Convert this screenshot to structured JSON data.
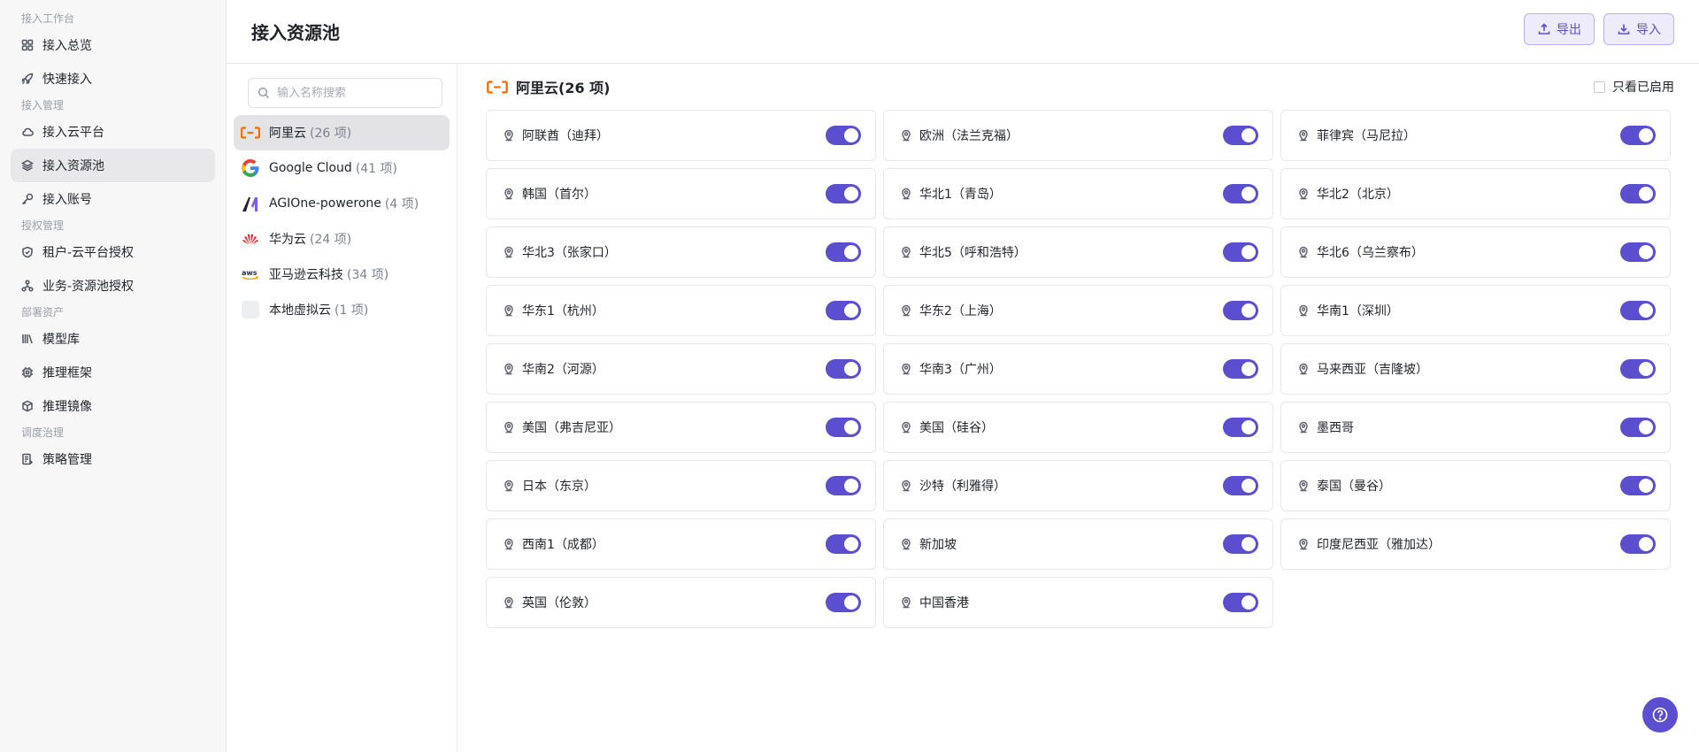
{
  "nav": {
    "groups": [
      {
        "title": "接入工作台",
        "items": [
          {
            "label": "接入总览",
            "icon": "grid-icon"
          },
          {
            "label": "快速接入",
            "icon": "rocket-icon"
          }
        ]
      },
      {
        "title": "接入管理",
        "items": [
          {
            "label": "接入云平台",
            "icon": "cloud-icon"
          },
          {
            "label": "接入资源池",
            "icon": "layers-icon",
            "active": true
          },
          {
            "label": "接入账号",
            "icon": "key-icon"
          }
        ]
      },
      {
        "title": "授权管理",
        "items": [
          {
            "label": "租户-云平台授权",
            "icon": "shield-icon"
          },
          {
            "label": "业务-资源池授权",
            "icon": "network-icon"
          }
        ]
      },
      {
        "title": "部署资产",
        "items": [
          {
            "label": "模型库",
            "icon": "library-icon"
          },
          {
            "label": "推理框架",
            "icon": "chip-icon"
          },
          {
            "label": "推理镜像",
            "icon": "box-icon"
          }
        ]
      },
      {
        "title": "调度治理",
        "items": [
          {
            "label": "策略管理",
            "icon": "policy-icon"
          }
        ]
      }
    ]
  },
  "header": {
    "title": "接入资源池",
    "export_label": "导出",
    "import_label": "导入"
  },
  "providers": {
    "search_placeholder": "输入名称搜索",
    "items": [
      {
        "name": "阿里云",
        "count": "(26 项)",
        "logo": "aliyun-logo",
        "active": true
      },
      {
        "name": "Google Cloud",
        "count": "(41 项)",
        "logo": "google-logo"
      },
      {
        "name": "AGIOne-powerone",
        "count": "(4 项)",
        "logo": "agione-logo"
      },
      {
        "name": "华为云",
        "count": "(24 项)",
        "logo": "huawei-logo"
      },
      {
        "name": "亚马逊云科技",
        "count": "(34 项)",
        "logo": "aws-logo"
      },
      {
        "name": "本地虚拟云",
        "count": "(1 项)",
        "logo": "local-cloud-logo"
      }
    ]
  },
  "main": {
    "title": "阿里云(26 项)",
    "filter_label": "只看已启用",
    "filter_checked": false,
    "regions": [
      {
        "name": "阿联酋（迪拜）",
        "enabled": true
      },
      {
        "name": "欧洲（法兰克福）",
        "enabled": true
      },
      {
        "name": "菲律宾（马尼拉）",
        "enabled": true
      },
      {
        "name": "韩国（首尔）",
        "enabled": true
      },
      {
        "name": "华北1（青岛）",
        "enabled": true
      },
      {
        "name": "华北2（北京）",
        "enabled": true
      },
      {
        "name": "华北3（张家口）",
        "enabled": true
      },
      {
        "name": "华北5（呼和浩特）",
        "enabled": true
      },
      {
        "name": "华北6（乌兰察布）",
        "enabled": true
      },
      {
        "name": "华东1（杭州）",
        "enabled": true
      },
      {
        "name": "华东2（上海）",
        "enabled": true
      },
      {
        "name": "华南1（深圳）",
        "enabled": true
      },
      {
        "name": "华南2（河源）",
        "enabled": true
      },
      {
        "name": "华南3（广州）",
        "enabled": true
      },
      {
        "name": "马来西亚（吉隆坡）",
        "enabled": true
      },
      {
        "name": "美国（弗吉尼亚）",
        "enabled": true
      },
      {
        "name": "美国（硅谷）",
        "enabled": true
      },
      {
        "name": "墨西哥",
        "enabled": true
      },
      {
        "name": "日本（东京）",
        "enabled": true
      },
      {
        "name": "沙特（利雅得）",
        "enabled": true
      },
      {
        "name": "泰国（曼谷）",
        "enabled": true
      },
      {
        "name": "西南1（成都）",
        "enabled": true
      },
      {
        "name": "新加坡",
        "enabled": true
      },
      {
        "name": "印度尼西亚（雅加达）",
        "enabled": true
      },
      {
        "name": "英国（伦敦）",
        "enabled": true
      },
      {
        "name": "中国香港",
        "enabled": true
      }
    ]
  },
  "colors": {
    "accent": "#5b4fd0",
    "aliyun_orange": "#ff6a00",
    "huawei_red": "#e3262e"
  }
}
